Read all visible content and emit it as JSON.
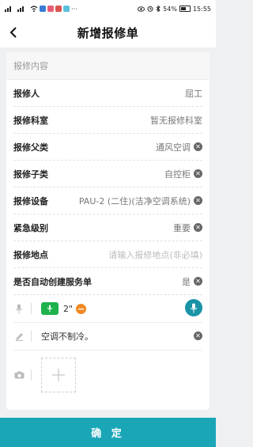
{
  "status": {
    "battery": "54%",
    "time": "15:55",
    "more": "···"
  },
  "nav": {
    "title": "新增报修单"
  },
  "form": {
    "section_title": "报修内容",
    "rows": [
      {
        "label": "报修人",
        "value": "屈工",
        "clearable": false,
        "placeholder": false
      },
      {
        "label": "报修科室",
        "value": "暂无报修科室",
        "clearable": false,
        "placeholder": false
      },
      {
        "label": "报修父类",
        "value": "通风空调",
        "clearable": true,
        "placeholder": false
      },
      {
        "label": "报修子类",
        "value": "自控柜",
        "clearable": true,
        "placeholder": false
      },
      {
        "label": "报修设备",
        "value": "PAU-2 (二住)(洁净空调系统)",
        "clearable": true,
        "placeholder": false
      },
      {
        "label": "紧急级别",
        "value": "重要",
        "clearable": true,
        "placeholder": false
      },
      {
        "label": "报修地点",
        "value": "请输入报修地点(非必填)",
        "clearable": false,
        "placeholder": true
      },
      {
        "label": "是否自动创建服务单",
        "value": "是",
        "clearable": true,
        "placeholder": false
      }
    ],
    "voice": {
      "duration": "2\""
    },
    "description": "空调不制冷。"
  },
  "footer": {
    "confirm_label": "确 定"
  },
  "colors": {
    "accent": "#1aa6b7",
    "voice_green": "#1db24c",
    "remove_orange": "#f08a24"
  }
}
